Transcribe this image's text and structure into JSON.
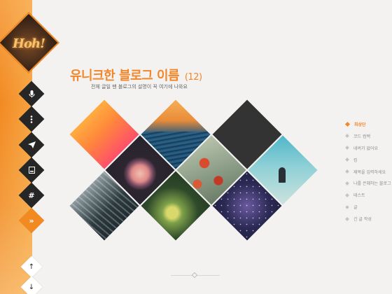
{
  "blog": {
    "logo_text": "Hoh!",
    "title": "유니크한 블로그 이름",
    "post_count": "(12)",
    "description": "전체 글일 땐 블로그의 설명이 꼭 여기에 나와요"
  },
  "sidebar": {
    "buttons": [
      {
        "name": "microphone-icon",
        "glyph": "🎤"
      },
      {
        "name": "more-icon",
        "glyph": "⋮"
      },
      {
        "name": "send-icon",
        "glyph": "➤"
      },
      {
        "name": "book-icon",
        "glyph": "▣"
      },
      {
        "name": "hashtag-icon",
        "glyph": "#"
      },
      {
        "name": "expand-icon",
        "glyph": "»"
      }
    ],
    "scroll_up": "↑",
    "scroll_down": "↓"
  },
  "posts": [
    {
      "label": "최상단",
      "active": true
    },
    {
      "label": "코드 컴백",
      "active": false
    },
    {
      "label": "네버가 없어요",
      "active": false
    },
    {
      "label": "킹",
      "active": false
    },
    {
      "label": "제목을 입력하세요",
      "active": false
    },
    {
      "label": "나를 은혜하는 블로그",
      "active": false
    },
    {
      "label": "테스트",
      "active": false
    },
    {
      "label": "글",
      "active": false
    },
    {
      "label": "긴 글 작성",
      "active": false
    }
  ],
  "footer": {
    "text": ""
  },
  "colors": {
    "accent": "#f2872a",
    "dark": "#262626",
    "background": "#f3f2f1"
  }
}
